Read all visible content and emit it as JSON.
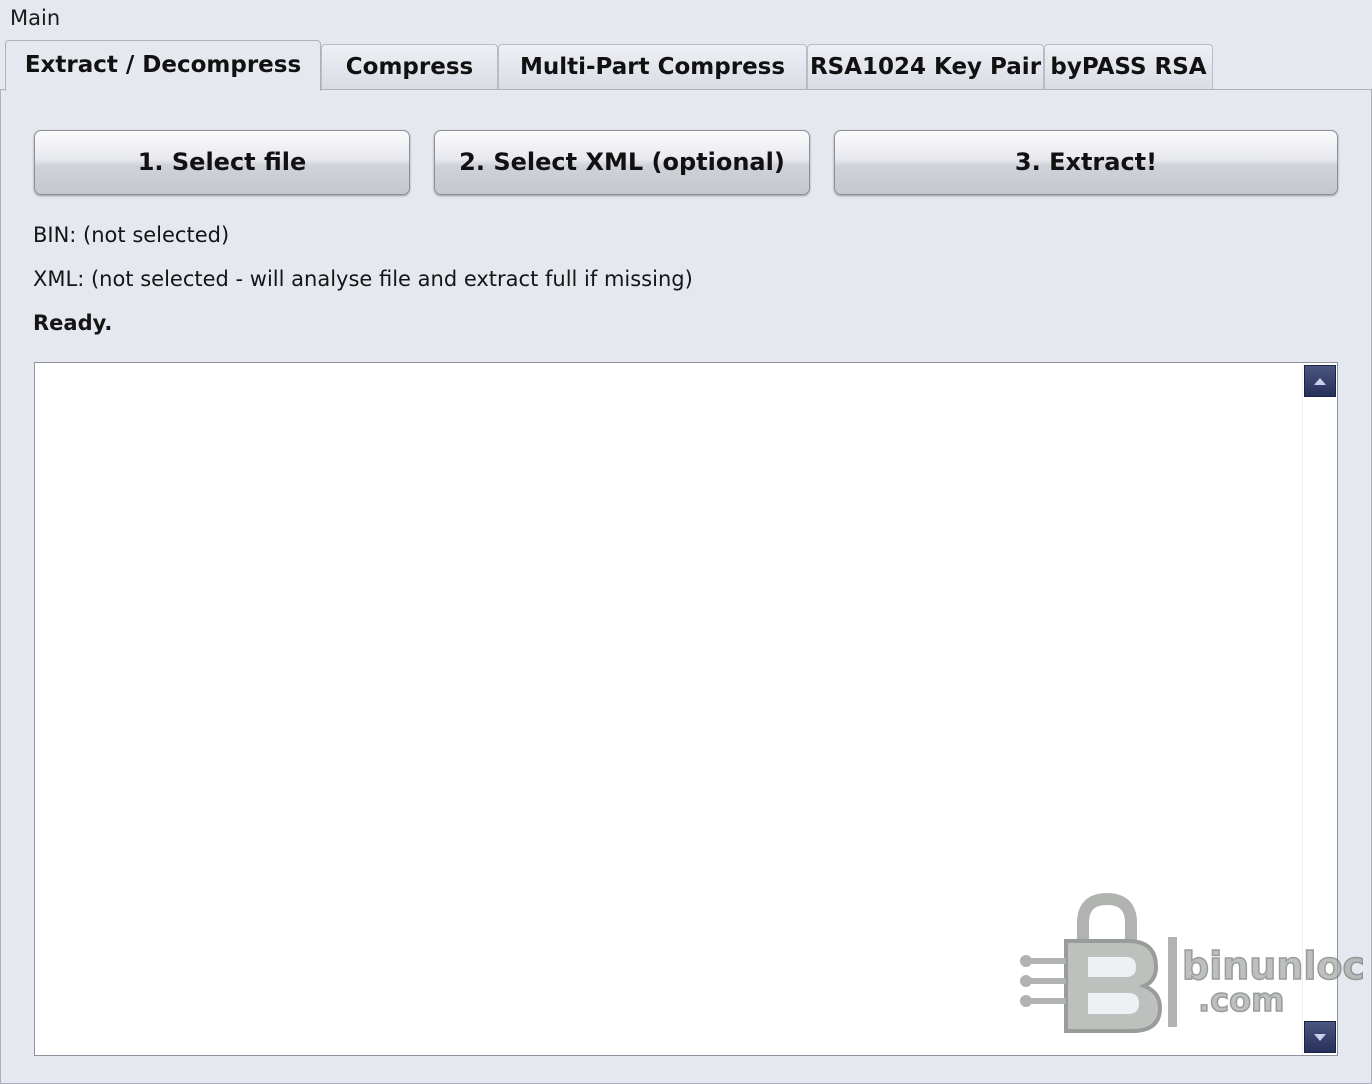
{
  "window": {
    "title": "Main"
  },
  "tabs": [
    {
      "label": "Extract / Decompress",
      "active": true
    },
    {
      "label": "Compress",
      "active": false
    },
    {
      "label": "Multi-Part Compress",
      "active": false
    },
    {
      "label": "RSA1024 Key Pair",
      "active": false
    },
    {
      "label": "byPASS RSA",
      "active": false
    }
  ],
  "actions": {
    "select_file": "1. Select file",
    "select_xml": "2. Select XML (optional)",
    "extract": "3. Extract!"
  },
  "status": {
    "bin": "BIN: (not selected)",
    "xml": "XML: (not selected - will analyse file and extract full if missing)",
    "state": "Ready."
  },
  "log": {
    "text": ""
  },
  "icons": {
    "scroll_up": "arrow-up-icon",
    "scroll_down": "arrow-down-icon",
    "watermark": "binunlock-logo"
  },
  "watermark": {
    "text_line1": "binunlock",
    "text_line2": ".com"
  },
  "colors": {
    "background": "#e6e8ef",
    "scroll_button": "#2b3360"
  }
}
